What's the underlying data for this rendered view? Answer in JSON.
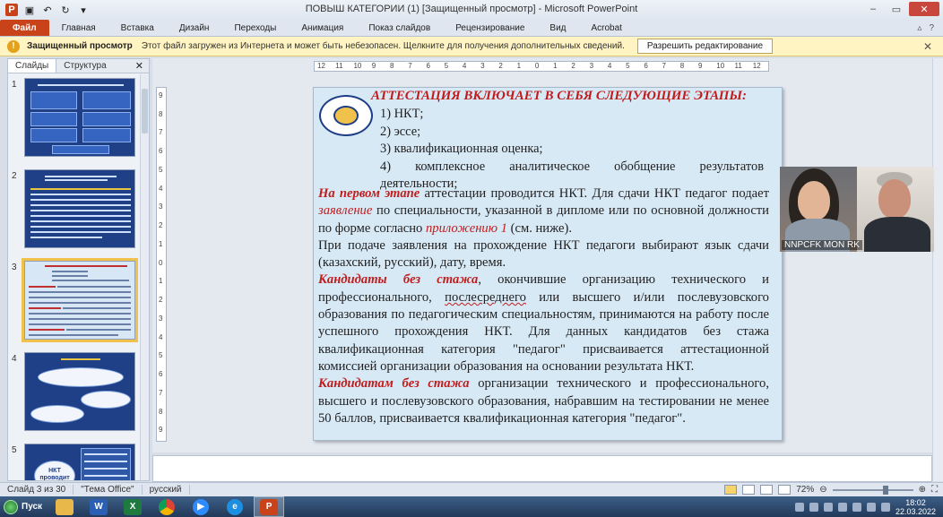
{
  "window": {
    "title": "ПОВЫШ КАТЕГОРИИ (1) [Защищенный просмотр] - Microsoft PowerPoint",
    "app_logo": "P"
  },
  "ribbon": {
    "file_tab": "Файл",
    "tabs": [
      "Главная",
      "Вставка",
      "Дизайн",
      "Переходы",
      "Анимация",
      "Показ слайдов",
      "Рецензирование",
      "Вид",
      "Acrobat"
    ]
  },
  "protected_bar": {
    "title": "Защищенный просмотр",
    "message": "Этот файл загружен из Интернета и может быть небезопасен. Щелкните для получения дополнительных сведений.",
    "enable_button": "Разрешить редактирование"
  },
  "side_panel": {
    "tab_slides": "Слайды",
    "tab_outline": "Структура",
    "thumbnails": [
      {
        "num": "1"
      },
      {
        "num": "2"
      },
      {
        "num": "3",
        "selected": true
      },
      {
        "num": "4"
      },
      {
        "num": "5",
        "label": "НКТ проводит"
      }
    ]
  },
  "ruler": {
    "h_labels": [
      "12",
      "11",
      "10",
      "9",
      "8",
      "7",
      "6",
      "5",
      "4",
      "3",
      "2",
      "1",
      "0",
      "1",
      "2",
      "3",
      "4",
      "5",
      "6",
      "7",
      "8",
      "9",
      "10",
      "11",
      "12"
    ],
    "v_labels": [
      "9",
      "8",
      "7",
      "6",
      "5",
      "4",
      "3",
      "2",
      "1",
      "0",
      "1",
      "2",
      "3",
      "4",
      "5",
      "6",
      "7",
      "8",
      "9"
    ]
  },
  "slide": {
    "title": "АТТЕСТАЦИЯ ВКЛЮЧАЕТ В СЕБЯ СЛЕДУЮЩИЕ ЭТАПЫ:",
    "list": [
      "1) НКТ;",
      "2) эссе;",
      "3) квалификационная  оценка;",
      "4)  комплексное  аналитическое  обобщение  результатов"
    ],
    "list_tail": "деятельности;",
    "p1": {
      "lead": "На первом этапе",
      "t1": " аттестации проводится НКТ. Для сдачи НКТ педагог подает ",
      "link1": "заявление",
      "t2": " по специальности, указанной в дипломе или по основной должности по форме согласно ",
      "link2": "приложению 1",
      "t3": " (см. ниже)."
    },
    "p2": "При подаче заявления на прохождение НКТ педагоги выбирают язык сдачи (казахский, русский), дату, время.",
    "p3": {
      "lead": "Кандидаты без стажа",
      "t1": ", окончившие организацию технического и профессионального, ",
      "wavy": "послесреднего",
      "t2": " или высшего и/или послевузовского образования по педагогическим специальностям, принимаются на работу после успешного прохождения НКТ. Для данных кандидатов без стажа квалификационная категория \"педагог\" присваивается аттестационной комиссией организации образования на основании результата  НКТ."
    },
    "p4": {
      "lead": "Кандидатам без стажа",
      "t1": " организации технического и профессионального, высшего и послевузовского образования, набравшим на тестировании не менее 50 баллов, присваивается квалификационная категория \"педагог\"."
    }
  },
  "video": {
    "label": "NNPCFK MON RK"
  },
  "status": {
    "slide_info": "Слайд 3 из 30",
    "theme": "\"Тема Office\"",
    "language": "русский",
    "zoom": "72%"
  },
  "taskbar": {
    "start": "Пуск",
    "time": "18:02",
    "date": "22.03.2022"
  }
}
